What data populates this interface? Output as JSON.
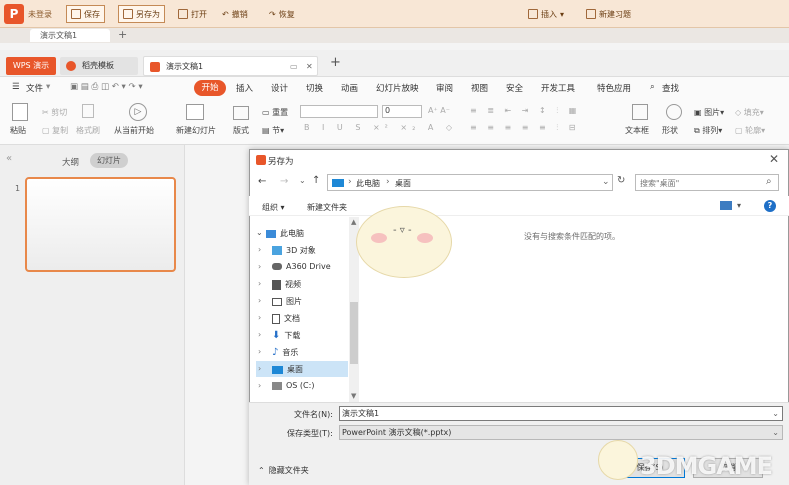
{
  "topbar": {
    "login": "未登录",
    "save": "保存",
    "saveas": "另存为",
    "open": "打开",
    "undo": "撤销",
    "redo": "恢复",
    "insert": "插入",
    "new_exercise": "新建习题"
  },
  "tabs_row1": {
    "doc": "演示文稿1"
  },
  "tabs_row2": {
    "wps": "WPS 演示",
    "template": "稻壳模板",
    "pres": "演示文稿1"
  },
  "menu": {
    "file": "文件",
    "start": "开始",
    "items": [
      "插入",
      "设计",
      "切换",
      "动画",
      "幻灯片放映",
      "审阅",
      "视图",
      "安全",
      "开发工具",
      "特色应用"
    ],
    "search": "查找"
  },
  "ribbon": {
    "cut": "剪切",
    "copy": "复制",
    "paste": "粘贴",
    "format_painter": "格式刷",
    "from_current": "从当前开始",
    "new_slide": "新建幻灯片",
    "layout": "版式",
    "section": "节",
    "reset": "重置",
    "font_size": "0",
    "textbox": "文本框",
    "shape": "形状",
    "arrange": "排列",
    "picture": "图片",
    "fill": "填充",
    "outline": "轮廓"
  },
  "left_panel": {
    "outline": "大纲",
    "slides": "幻灯片",
    "slide_num": "1"
  },
  "dialog": {
    "title": "另存为",
    "breadcrumb": [
      "此电脑",
      "桌面"
    ],
    "search_placeholder": "搜索\"桌面\"",
    "organize": "组织",
    "new_folder": "新建文件夹",
    "tree": [
      "此电脑",
      "3D 对象",
      "A360 Drive",
      "视频",
      "图片",
      "文档",
      "下载",
      "音乐",
      "桌面",
      "OS (C:)"
    ],
    "empty": "没有与搜索条件匹配的项。",
    "filename_label": "文件名(N):",
    "filename_value": "演示文稿1",
    "filetype_label": "保存类型(T):",
    "filetype_value": "PowerPoint 演示文稿(*.pptx)",
    "hide_folders": "隐藏文件夹",
    "save": "保存(S)",
    "cancel": "取消"
  },
  "watermark": "3DMGAME",
  "colors": {
    "accent": "#e8562a",
    "selection": "#cce4f7"
  }
}
